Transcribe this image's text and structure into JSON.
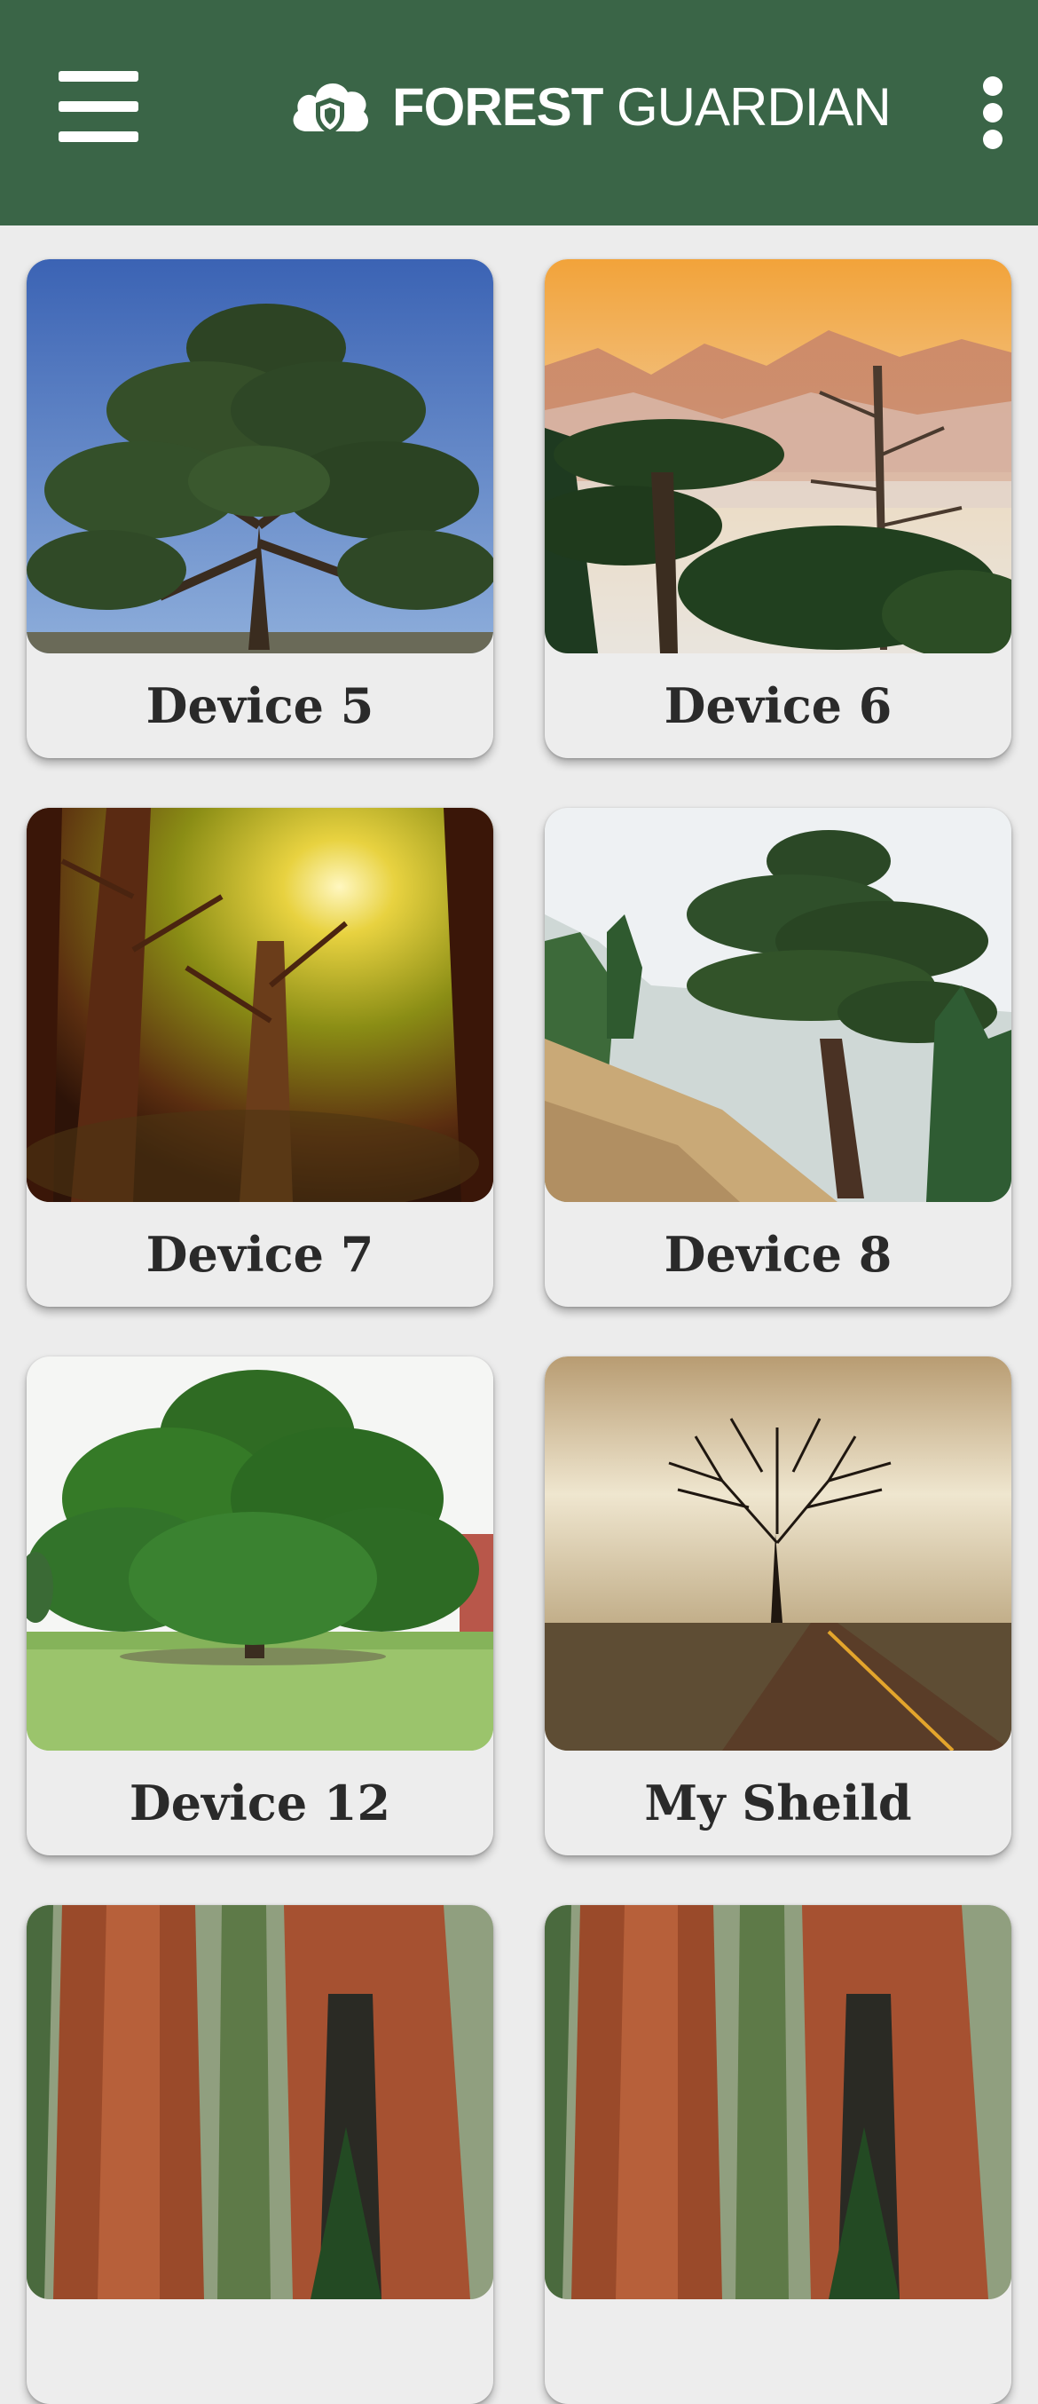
{
  "header": {
    "brand_bold": "FOREST",
    "brand_thin": " GUARDIAN",
    "menu_icon": "hamburger-menu-icon",
    "more_icon": "more-vertical-icon",
    "logo_icon": "cloud-shield-logo-icon",
    "color": "#3a6547"
  },
  "devices": [
    {
      "label": "Device 5",
      "image": "cedar-tree-blue-sky"
    },
    {
      "label": "Device 6",
      "image": "cedars-misty-mountains-sunset"
    },
    {
      "label": "Device 7",
      "image": "sunlit-forest-canopy"
    },
    {
      "label": "Device 8",
      "image": "cedar-on-hillside"
    },
    {
      "label": "Device 12",
      "image": "large-tree-on-lawn"
    },
    {
      "label": "My Sheild",
      "image": "lone-tree-by-road"
    },
    {
      "label": "",
      "image": "sequoia-trunks"
    },
    {
      "label": "",
      "image": "sequoia-trunks"
    }
  ],
  "colors": {
    "background": "#ececec",
    "card": "#ededed",
    "label_text": "#2a2a2a"
  }
}
